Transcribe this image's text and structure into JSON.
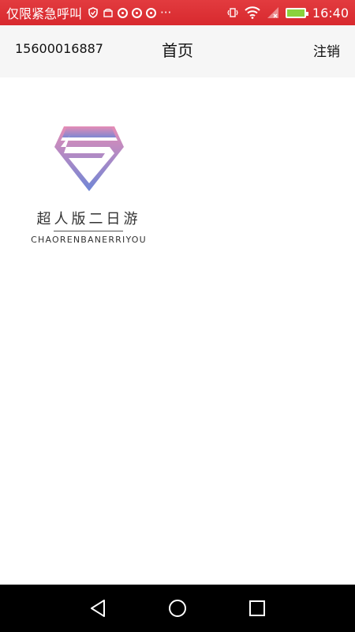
{
  "status_bar": {
    "emergency_text": "仅限紧急呼叫",
    "overflow": "···",
    "time": "16:40"
  },
  "header": {
    "phone": "15600016887",
    "title": "首页",
    "logout_label": "注销"
  },
  "logo": {
    "cn": "超人版二日游",
    "en": "CHAORENBANERRIYOU",
    "colors": {
      "top": "#e58db6",
      "bottom": "#6f86d6"
    }
  },
  "nav": {
    "icons": [
      "back-icon",
      "home-icon",
      "recents-icon"
    ]
  }
}
